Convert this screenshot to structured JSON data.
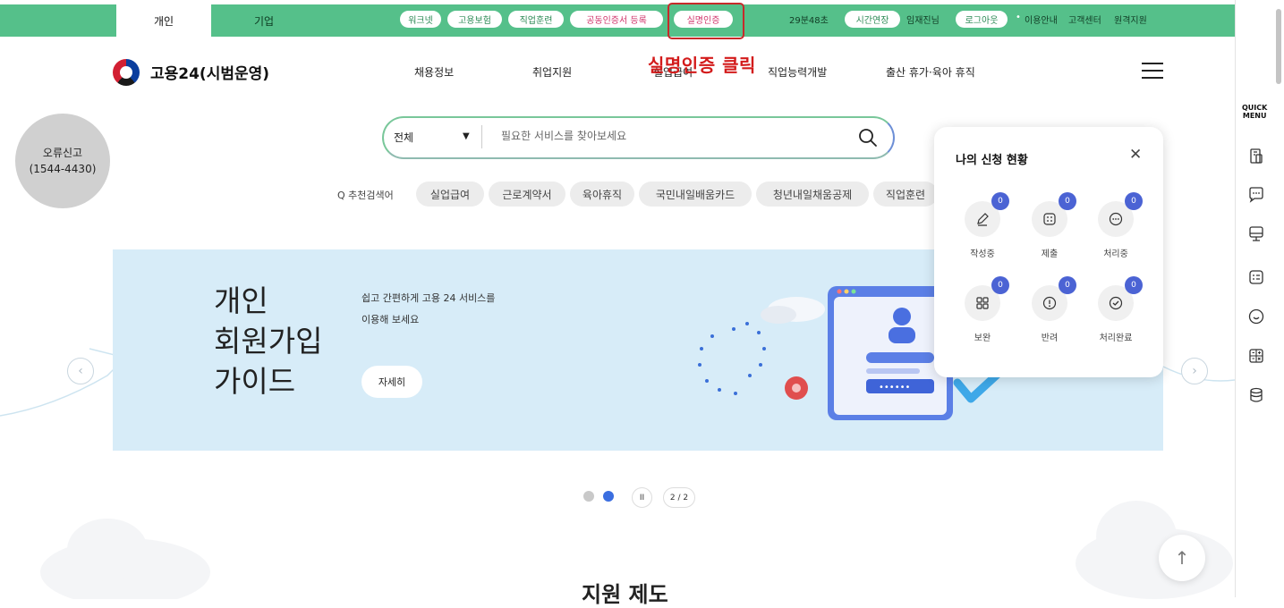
{
  "topbar": {
    "tabs": [
      {
        "label": "개인"
      },
      {
        "label": "기업"
      }
    ],
    "links": [
      {
        "label": "워크넷"
      },
      {
        "label": "고용보험"
      },
      {
        "label": "직업훈련"
      },
      {
        "label": "공동인증서 등록"
      },
      {
        "label": "실명인증"
      }
    ],
    "session": {
      "timer": "29분48초",
      "extend_label": "시간연장",
      "user": "임재진님",
      "logout_label": "로그아웃",
      "bullet": "•",
      "guide": "이용안내",
      "customer_center": "고객센터",
      "remote_support": "원격지원"
    }
  },
  "annotation": {
    "text": "실명인증 클릭",
    "color": "#d31b1b"
  },
  "header": {
    "logo_text": "고용24(시범운영)",
    "nav": [
      {
        "label": "채용정보"
      },
      {
        "label": "취업지원"
      },
      {
        "label": "실업급여"
      },
      {
        "label": "직업능력개발"
      },
      {
        "label": "출산 휴가·육아 휴직"
      }
    ],
    "menu_icon": "hamburger-icon"
  },
  "error_report": {
    "label": "오류신고",
    "phone": "(1544-4430)"
  },
  "search": {
    "category": "전체",
    "caret": "▼",
    "placeholder": "필요한 서비스를 찾아보세요",
    "icon": "search-icon"
  },
  "recommend": {
    "label": "Q 추천검색어",
    "keywords": [
      {
        "label": "실업급여"
      },
      {
        "label": "근로계약서"
      },
      {
        "label": "육아휴직"
      },
      {
        "label": "국민내일배움카드"
      },
      {
        "label": "청년내일채움공제"
      },
      {
        "label": "직업훈련"
      }
    ]
  },
  "banner": {
    "title": "개인\n회원가입\n가이드",
    "desc": "쉽고 간편하게 고용 24 서비스를\n이용해 보세요",
    "button_label": "자세히",
    "prev_icon": "chevron-left-icon",
    "next_icon": "chevron-right-icon"
  },
  "slider": {
    "pause_label": "II",
    "pager": "2 / 2",
    "active_index": 2,
    "total": 2
  },
  "application_status": {
    "title": "나의 신청 현황",
    "close_icon": "close-icon",
    "items": [
      {
        "label": "작성중",
        "count": "0",
        "icon": "pencil-icon"
      },
      {
        "label": "제출",
        "count": "0",
        "icon": "checklist-icon"
      },
      {
        "label": "처리중",
        "count": "0",
        "icon": "more-circle-icon"
      },
      {
        "label": "보완",
        "count": "0",
        "icon": "grid-icon"
      },
      {
        "label": "반려",
        "count": "0",
        "icon": "alert-circle-icon"
      },
      {
        "label": "처리완료",
        "count": "0",
        "icon": "check-circle-icon"
      }
    ]
  },
  "quick_menu": {
    "label": "QUICK\nMENU",
    "icons": [
      "document-icon",
      "chat-icon",
      "monitor-icon",
      "checklist-icon",
      "smile-icon",
      "calculator-icon",
      "database-icon"
    ]
  },
  "section": {
    "title": "지원 제도"
  },
  "colors": {
    "topbar": "#55c08a",
    "accent_blue": "#4b63d4",
    "banner_bg": "#d7ecf8",
    "highlight_red": "#c62a2a"
  }
}
